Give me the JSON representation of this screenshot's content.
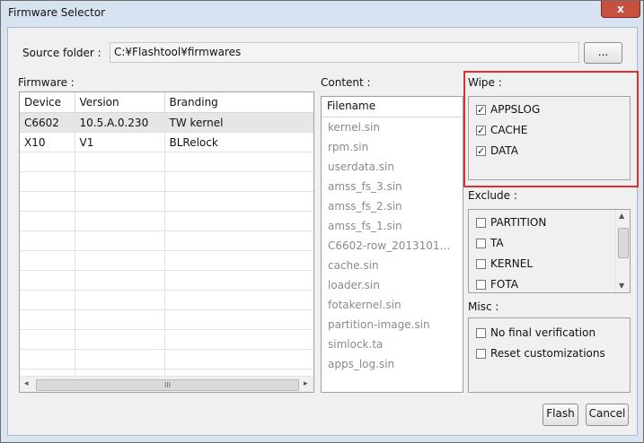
{
  "window": {
    "title": "Firmware Selector",
    "close_glyph": "x"
  },
  "source": {
    "label": "Source folder :",
    "value": "C:¥Flashtool¥firmwares",
    "browse_label": "..."
  },
  "firmware": {
    "label": "Firmware :",
    "columns": [
      "Device",
      "Version",
      "Branding"
    ],
    "rows": [
      {
        "device": "C6602",
        "version": "10.5.A.0.230",
        "branding": "TW kernel",
        "selected": true
      },
      {
        "device": "X10",
        "version": "V1",
        "branding": "BLRelock",
        "selected": false
      }
    ],
    "hscroll_thumb_glyph": "III"
  },
  "content": {
    "label": "Content :",
    "header": "Filename",
    "files": [
      "kernel.sin",
      "rpm.sin",
      "userdata.sin",
      "amss_fs_3.sin",
      "amss_fs_2.sin",
      "amss_fs_1.sin",
      "C6602-row_20131017...",
      "cache.sin",
      "loader.sin",
      "fotakernel.sin",
      "partition-image.sin",
      "simlock.ta",
      "apps_log.sin"
    ]
  },
  "wipe": {
    "label": "Wipe :",
    "items": [
      {
        "label": "APPSLOG",
        "checked": true
      },
      {
        "label": "CACHE",
        "checked": true
      },
      {
        "label": "DATA",
        "checked": true
      }
    ]
  },
  "exclude": {
    "label": "Exclude :",
    "items": [
      {
        "label": "PARTITION",
        "checked": false
      },
      {
        "label": "TA",
        "checked": false
      },
      {
        "label": "KERNEL",
        "checked": false
      },
      {
        "label": "FOTA",
        "checked": false
      }
    ]
  },
  "misc": {
    "label": "Misc :",
    "items": [
      {
        "label": "No final verification",
        "checked": false
      },
      {
        "label": "Reset customizations",
        "checked": false
      }
    ]
  },
  "actions": {
    "flash_label": "Flash",
    "cancel_label": "Cancel"
  },
  "colors": {
    "highlight_border": "#e0302c",
    "close_button": "#c7503f",
    "disabled_text": "#8a8a8a"
  }
}
